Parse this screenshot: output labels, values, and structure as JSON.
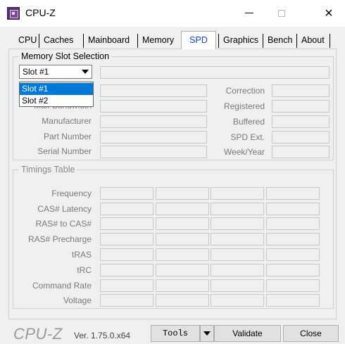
{
  "window": {
    "title": "CPU-Z",
    "close_glyph": "×"
  },
  "tabs": [
    {
      "label": "CPU"
    },
    {
      "label": "Caches"
    },
    {
      "label": "Mainboard"
    },
    {
      "label": "Memory"
    },
    {
      "label": "SPD"
    },
    {
      "label": "Graphics"
    },
    {
      "label": "Bench"
    },
    {
      "label": "About"
    }
  ],
  "active_tab": "SPD",
  "slot_selection": {
    "title": "Memory Slot Selection",
    "selected": "Slot #1",
    "options": [
      "Slot #1",
      "Slot #2"
    ],
    "labels_left": [
      "Max Bandwidth",
      "Manufacturer",
      "Part Number",
      "Serial Number"
    ],
    "labels_right": [
      "Correction",
      "Registered",
      "Buffered",
      "SPD Ext.",
      "Week/Year"
    ]
  },
  "timings": {
    "title": "Timings Table",
    "rows": [
      "Frequency",
      "CAS# Latency",
      "RAS# to CAS#",
      "RAS# Precharge",
      "tRAS",
      "tRC",
      "Command Rate",
      "Voltage"
    ]
  },
  "footer": {
    "brand": "CPU-Z",
    "version": "Ver. 1.75.0.x64",
    "tools_label": "Tools",
    "validate_label": "Validate",
    "close_label": "Close"
  },
  "colors": {
    "active_tab_text": "#1a3fd6",
    "selection": "#0078d7",
    "app_icon": "#5a2d6e"
  }
}
